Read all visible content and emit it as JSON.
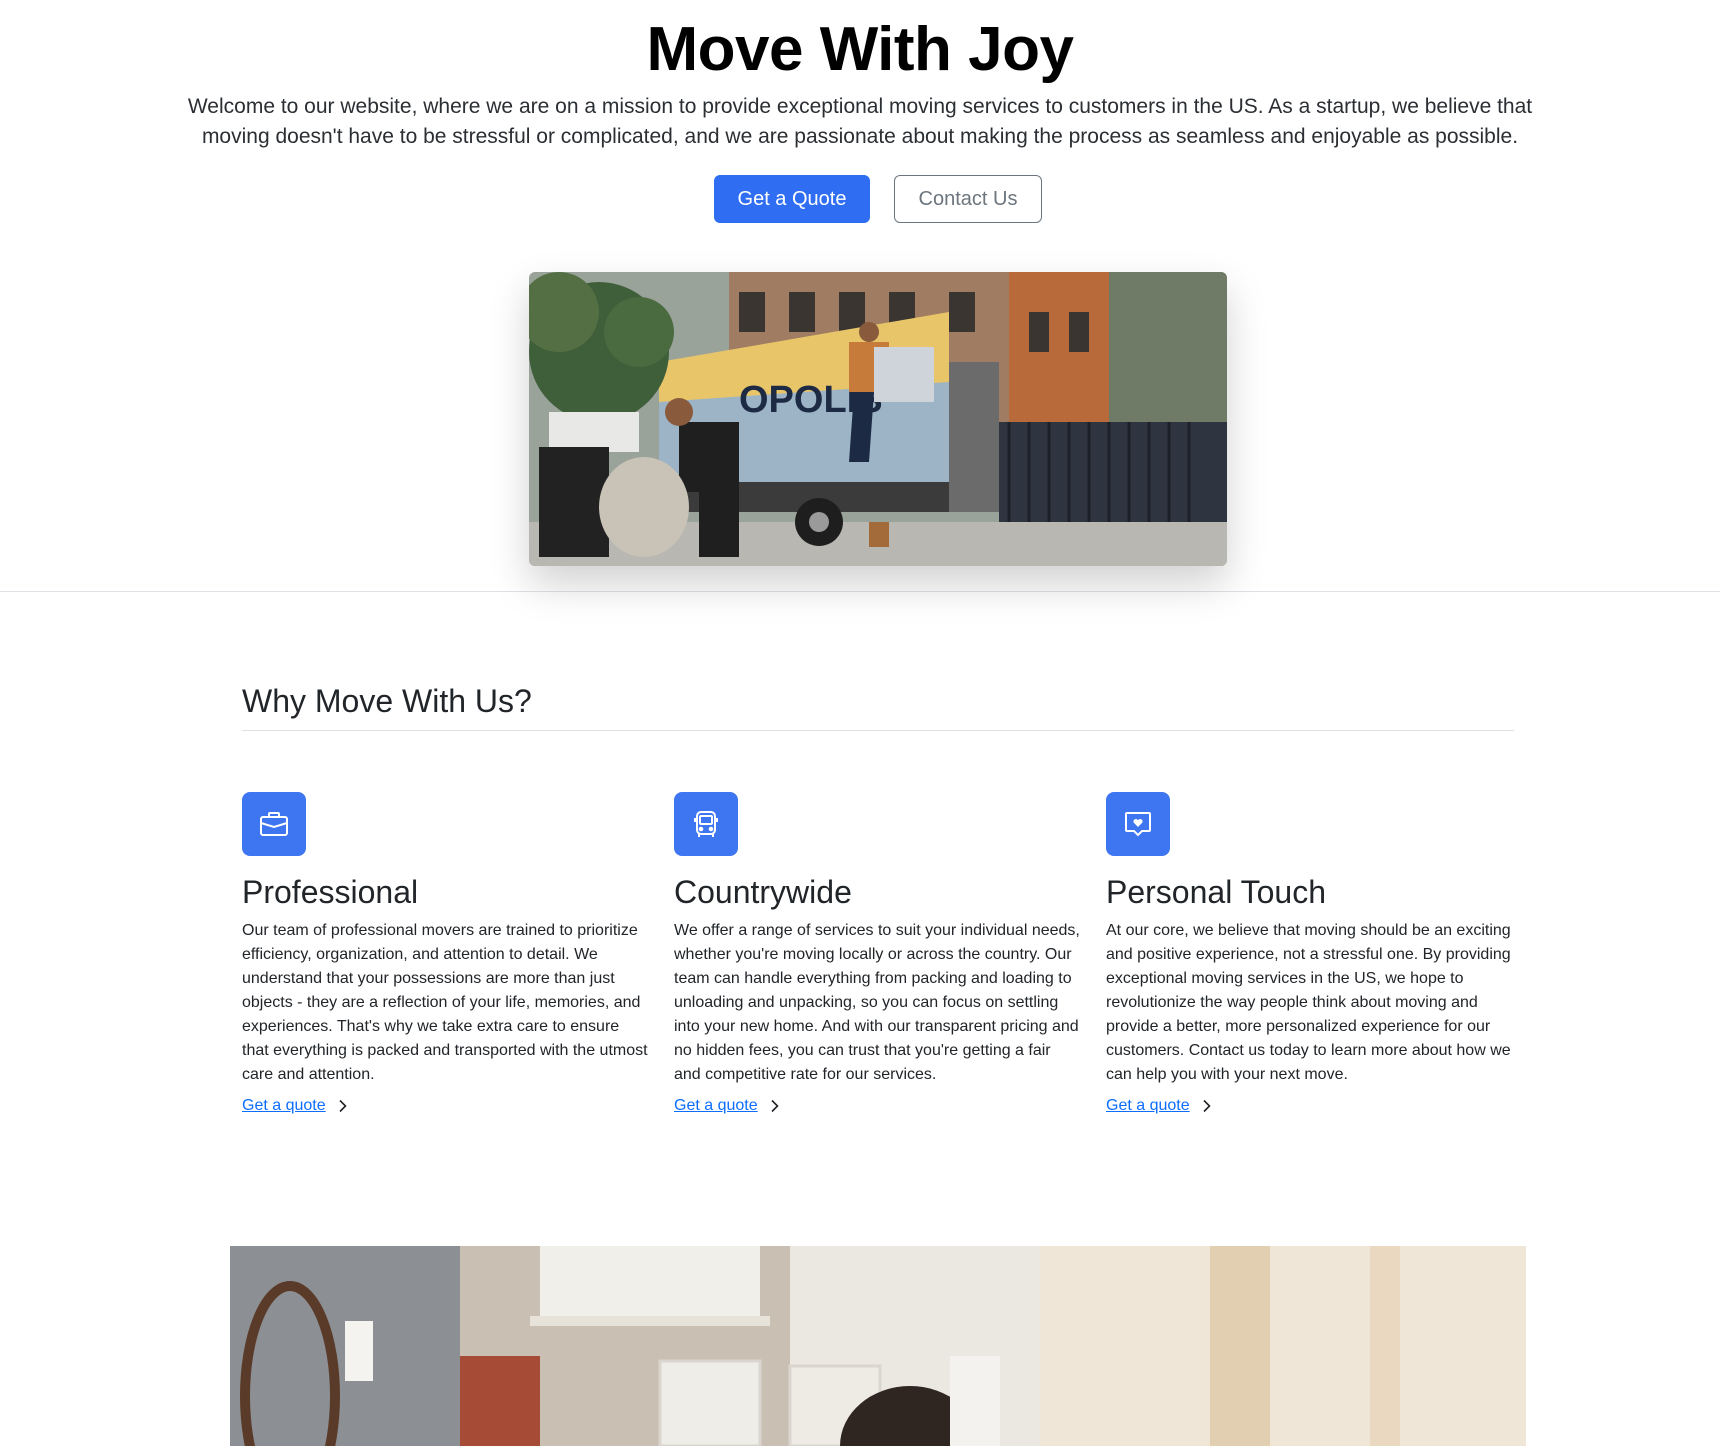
{
  "hero": {
    "title": "Move With Joy",
    "lead": "Welcome to our website, where we are on a mission to provide exceptional moving services to customers in the US. As a startup, we believe that moving doesn't have to be stressful or complicated, and we are passionate about making the process as seamless and enjoyable as possible.",
    "primary_button": "Get a Quote",
    "secondary_button": "Contact Us",
    "image_alt": "Movers loading a plant into a moving truck"
  },
  "why": {
    "heading": "Why Move With Us?",
    "features": [
      {
        "icon": "briefcase-icon",
        "title": "Professional",
        "text": "Our team of professional movers are trained to prioritize efficiency, organization, and attention to detail. We understand that your possessions are more than just objects - they are a reflection of your life, memories, and experiences. That's why we take extra care to ensure that everything is packed and transported with the utmost care and attention.",
        "link": "Get a quote"
      },
      {
        "icon": "bus-icon",
        "title": "Countrywide",
        "text": "We offer a range of services to suit your individual needs, whether you're moving locally or across the country. Our team can handle everything from packing and loading to unloading and unpacking, so you can focus on settling into your new home. And with our transparent pricing and no hidden fees, you can trust that you're getting a fair and competitive rate for our services.",
        "link": "Get a quote"
      },
      {
        "icon": "chat-heart-icon",
        "title": "Personal Touch",
        "text": "At our core, we believe that moving should be an exciting and positive experience, not a stressful one. By providing exceptional moving services in the US, we hope to revolutionize the way people think about moving and provide a better, more personalized experience for our customers. Contact us today to learn more about how we can help you with your next move.",
        "link": "Get a quote"
      }
    ]
  },
  "colors": {
    "primary": "#2f6ef3",
    "icon_bg": "#3d76f0",
    "link": "#0d6efd"
  }
}
